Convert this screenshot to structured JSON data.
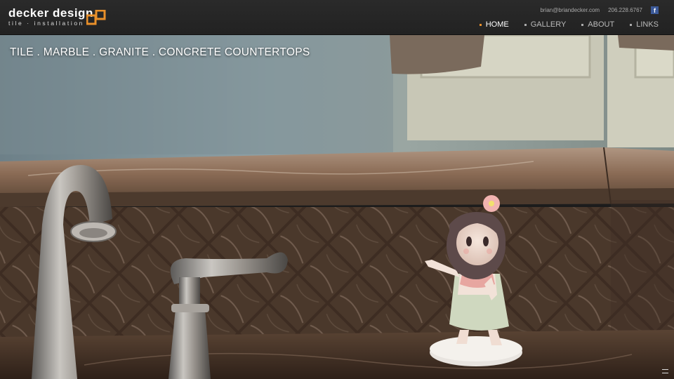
{
  "logo": {
    "title": "decker design",
    "subtitle": "tile · installation",
    "mark_icon": "orange-linked-squares-logo",
    "accent_color": "#e9902a"
  },
  "contact": {
    "email": "brian@briandecker.com",
    "phone": "206.228.6767",
    "facebook_icon": "facebook-icon",
    "facebook_glyph": "f"
  },
  "nav": {
    "items": [
      {
        "label": "HOME",
        "active": true
      },
      {
        "label": "GALLERY",
        "active": false
      },
      {
        "label": "ABOUT",
        "active": false
      },
      {
        "label": "LINKS",
        "active": false
      }
    ]
  },
  "hero": {
    "tagline": "TILE . MARBLE . GRANITE . CONCRETE COUNTERTOPS",
    "image_subject": "marble-backsplash-with-faucet-and-hula-figurine"
  }
}
